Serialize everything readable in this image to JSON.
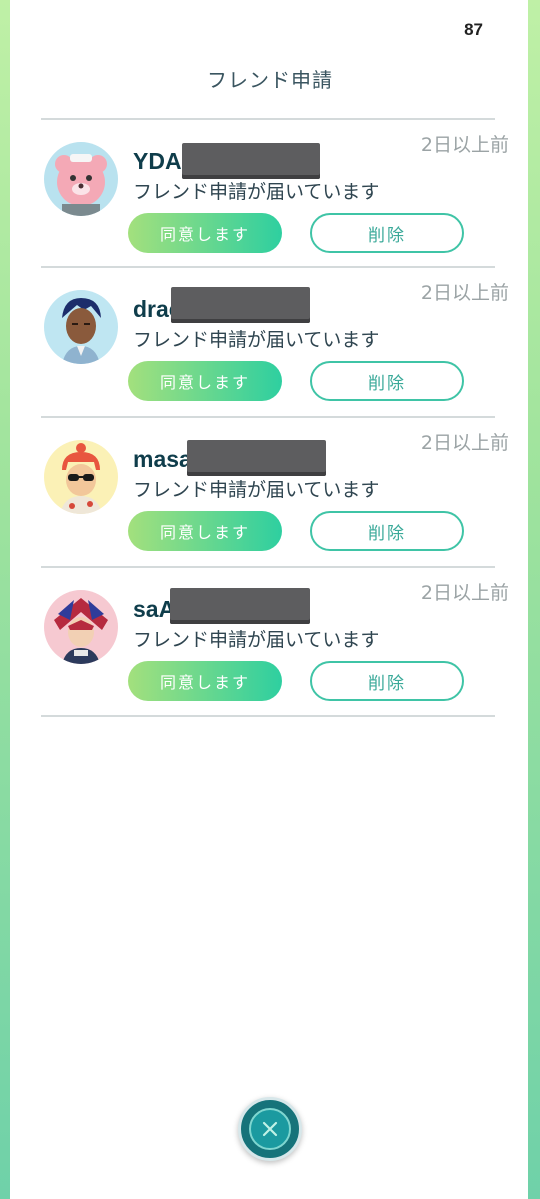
{
  "status": {
    "number": "87"
  },
  "header": {
    "title": "フレンド申請"
  },
  "requests": [
    {
      "name": "YDA",
      "message": "フレンド申請が届いています",
      "time": "2日以上前",
      "accept_label": "同意します",
      "delete_label": "削除"
    },
    {
      "name": "drac",
      "message": "フレンド申請が届いています",
      "time": "2日以上前",
      "accept_label": "同意します",
      "delete_label": "削除"
    },
    {
      "name": "masa",
      "message": "フレンド申請が届いています",
      "time": "2日以上前",
      "accept_label": "同意します",
      "delete_label": "削除"
    },
    {
      "name": "saA",
      "message": "フレンド申請が届いています",
      "time": "2日以上前",
      "accept_label": "同意します",
      "delete_label": "削除"
    }
  ],
  "footer": {
    "close_icon": "close-icon"
  },
  "colors": {
    "accent_start": "#a3e07d",
    "accent_end": "#2ecfa0",
    "close_bg": "#16737a"
  }
}
